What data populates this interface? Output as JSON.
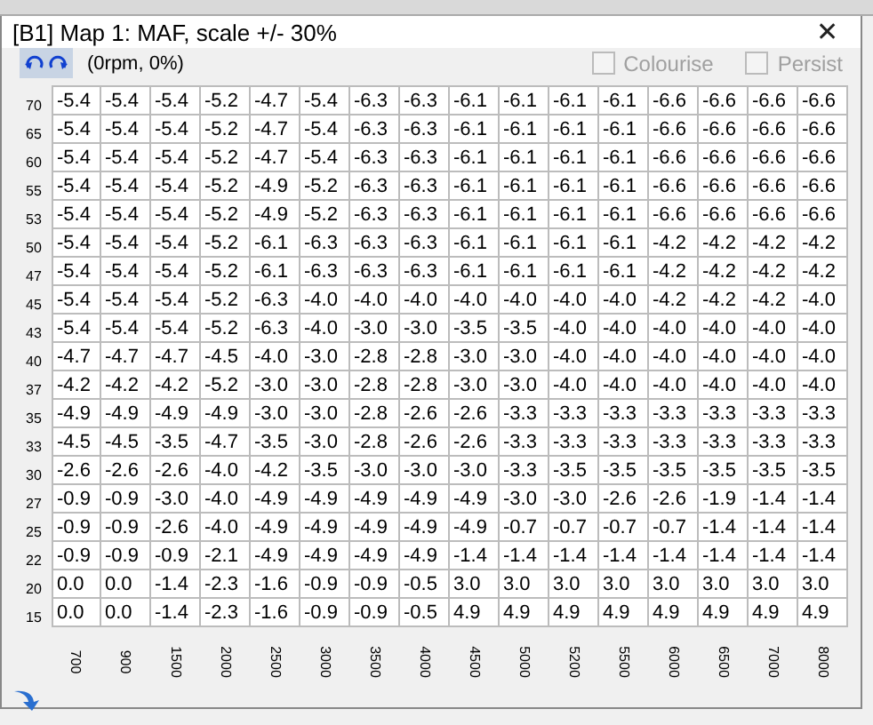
{
  "window": {
    "title": "[B1] Map 1: MAF, scale +/- 30%",
    "close": "✕"
  },
  "toolbar": {
    "position": "(0rpm, 0%)",
    "checkboxes": [
      {
        "label": "Colourise",
        "checked": false,
        "disabled": true
      },
      {
        "label": "Persist",
        "checked": false,
        "disabled": true
      }
    ]
  },
  "table": {
    "rows": [
      {
        "label": "70",
        "cells": [
          "-5.4",
          "-5.4",
          "-5.4",
          "-5.2",
          "-4.7",
          "-5.4",
          "-6.3",
          "-6.3",
          "-6.1",
          "-6.1",
          "-6.1",
          "-6.1",
          "-6.6",
          "-6.6",
          "-6.6",
          "-6.6"
        ]
      },
      {
        "label": "65",
        "cells": [
          "-5.4",
          "-5.4",
          "-5.4",
          "-5.2",
          "-4.7",
          "-5.4",
          "-6.3",
          "-6.3",
          "-6.1",
          "-6.1",
          "-6.1",
          "-6.1",
          "-6.6",
          "-6.6",
          "-6.6",
          "-6.6"
        ]
      },
      {
        "label": "60",
        "cells": [
          "-5.4",
          "-5.4",
          "-5.4",
          "-5.2",
          "-4.7",
          "-5.4",
          "-6.3",
          "-6.3",
          "-6.1",
          "-6.1",
          "-6.1",
          "-6.1",
          "-6.6",
          "-6.6",
          "-6.6",
          "-6.6"
        ]
      },
      {
        "label": "55",
        "cells": [
          "-5.4",
          "-5.4",
          "-5.4",
          "-5.2",
          "-4.9",
          "-5.2",
          "-6.3",
          "-6.3",
          "-6.1",
          "-6.1",
          "-6.1",
          "-6.1",
          "-6.6",
          "-6.6",
          "-6.6",
          "-6.6"
        ]
      },
      {
        "label": "53",
        "cells": [
          "-5.4",
          "-5.4",
          "-5.4",
          "-5.2",
          "-4.9",
          "-5.2",
          "-6.3",
          "-6.3",
          "-6.1",
          "-6.1",
          "-6.1",
          "-6.1",
          "-6.6",
          "-6.6",
          "-6.6",
          "-6.6"
        ]
      },
      {
        "label": "50",
        "cells": [
          "-5.4",
          "-5.4",
          "-5.4",
          "-5.2",
          "-6.1",
          "-6.3",
          "-6.3",
          "-6.3",
          "-6.1",
          "-6.1",
          "-6.1",
          "-6.1",
          "-4.2",
          "-4.2",
          "-4.2",
          "-4.2"
        ]
      },
      {
        "label": "47",
        "cells": [
          "-5.4",
          "-5.4",
          "-5.4",
          "-5.2",
          "-6.1",
          "-6.3",
          "-6.3",
          "-6.3",
          "-6.1",
          "-6.1",
          "-6.1",
          "-6.1",
          "-4.2",
          "-4.2",
          "-4.2",
          "-4.2"
        ]
      },
      {
        "label": "45",
        "cells": [
          "-5.4",
          "-5.4",
          "-5.4",
          "-5.2",
          "-6.3",
          "-4.0",
          "-4.0",
          "-4.0",
          "-4.0",
          "-4.0",
          "-4.0",
          "-4.0",
          "-4.2",
          "-4.2",
          "-4.2",
          "-4.0"
        ]
      },
      {
        "label": "43",
        "cells": [
          "-5.4",
          "-5.4",
          "-5.4",
          "-5.2",
          "-6.3",
          "-4.0",
          "-3.0",
          "-3.0",
          "-3.5",
          "-3.5",
          "-4.0",
          "-4.0",
          "-4.0",
          "-4.0",
          "-4.0",
          "-4.0"
        ]
      },
      {
        "label": "40",
        "cells": [
          "-4.7",
          "-4.7",
          "-4.7",
          "-4.5",
          "-4.0",
          "-3.0",
          "-2.8",
          "-2.8",
          "-3.0",
          "-3.0",
          "-4.0",
          "-4.0",
          "-4.0",
          "-4.0",
          "-4.0",
          "-4.0"
        ]
      },
      {
        "label": "37",
        "cells": [
          "-4.2",
          "-4.2",
          "-4.2",
          "-5.2",
          "-3.0",
          "-3.0",
          "-2.8",
          "-2.8",
          "-3.0",
          "-3.0",
          "-4.0",
          "-4.0",
          "-4.0",
          "-4.0",
          "-4.0",
          "-4.0"
        ]
      },
      {
        "label": "35",
        "cells": [
          "-4.9",
          "-4.9",
          "-4.9",
          "-4.9",
          "-3.0",
          "-3.0",
          "-2.8",
          "-2.6",
          "-2.6",
          "-3.3",
          "-3.3",
          "-3.3",
          "-3.3",
          "-3.3",
          "-3.3",
          "-3.3"
        ]
      },
      {
        "label": "33",
        "cells": [
          "-4.5",
          "-4.5",
          "-3.5",
          "-4.7",
          "-3.5",
          "-3.0",
          "-2.8",
          "-2.6",
          "-2.6",
          "-3.3",
          "-3.3",
          "-3.3",
          "-3.3",
          "-3.3",
          "-3.3",
          "-3.3"
        ]
      },
      {
        "label": "30",
        "cells": [
          "-2.6",
          "-2.6",
          "-2.6",
          "-4.0",
          "-4.2",
          "-3.5",
          "-3.0",
          "-3.0",
          "-3.0",
          "-3.3",
          "-3.5",
          "-3.5",
          "-3.5",
          "-3.5",
          "-3.5",
          "-3.5"
        ]
      },
      {
        "label": "27",
        "cells": [
          "-0.9",
          "-0.9",
          "-3.0",
          "-4.0",
          "-4.9",
          "-4.9",
          "-4.9",
          "-4.9",
          "-4.9",
          "-3.0",
          "-3.0",
          "-2.6",
          "-2.6",
          "-1.9",
          "-1.4",
          "-1.4"
        ]
      },
      {
        "label": "25",
        "cells": [
          "-0.9",
          "-0.9",
          "-2.6",
          "-4.0",
          "-4.9",
          "-4.9",
          "-4.9",
          "-4.9",
          "-4.9",
          "-0.7",
          "-0.7",
          "-0.7",
          "-0.7",
          "-1.4",
          "-1.4",
          "-1.4"
        ]
      },
      {
        "label": "22",
        "cells": [
          "-0.9",
          "-0.9",
          "-0.9",
          "-2.1",
          "-4.9",
          "-4.9",
          "-4.9",
          "-4.9",
          "-1.4",
          "-1.4",
          "-1.4",
          "-1.4",
          "-1.4",
          "-1.4",
          "-1.4",
          "-1.4"
        ]
      },
      {
        "label": "20",
        "cells": [
          "0.0",
          "0.0",
          "-1.4",
          "-2.3",
          "-1.6",
          "-0.9",
          "-0.9",
          "-0.5",
          "3.0",
          "3.0",
          "3.0",
          "3.0",
          "3.0",
          "3.0",
          "3.0",
          "3.0"
        ]
      },
      {
        "label": "15",
        "cells": [
          "0.0",
          "0.0",
          "-1.4",
          "-2.3",
          "-1.6",
          "-0.9",
          "-0.9",
          "-0.5",
          "4.9",
          "4.9",
          "4.9",
          "4.9",
          "4.9",
          "4.9",
          "4.9",
          "4.9"
        ]
      }
    ],
    "bottom_labels": [
      "700",
      "900",
      "1500",
      "2000",
      "2500",
      "3000",
      "3500",
      "4000",
      "4500",
      "5000",
      "5200",
      "5500",
      "6000",
      "6500",
      "7000",
      "8000"
    ]
  }
}
